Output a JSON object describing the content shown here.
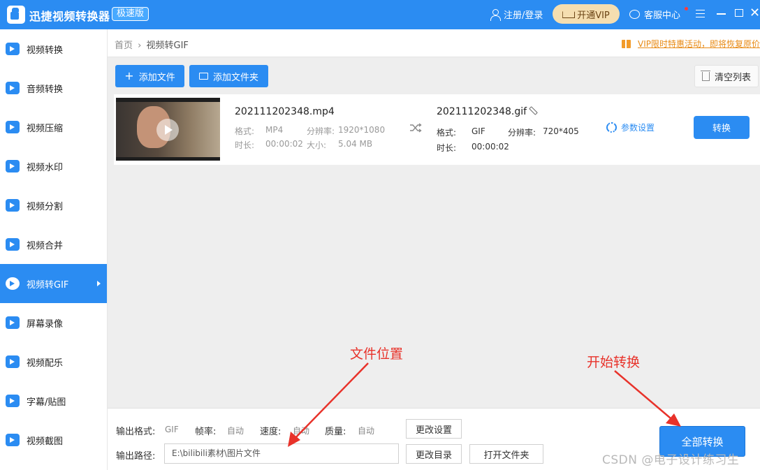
{
  "titlebar": {
    "app_name": "迅捷视频转换器",
    "edition": "极速版",
    "login": "注册/登录",
    "vip": "开通VIP",
    "service": "客服中心"
  },
  "sidebar": {
    "items": [
      {
        "label": "视频转换",
        "icon": "video-convert-icon"
      },
      {
        "label": "音频转换",
        "icon": "audio-convert-icon"
      },
      {
        "label": "视频压缩",
        "icon": "video-compress-icon"
      },
      {
        "label": "视频水印",
        "icon": "watermark-icon"
      },
      {
        "label": "视频分割",
        "icon": "split-icon"
      },
      {
        "label": "视频合并",
        "icon": "merge-icon"
      },
      {
        "label": "视频转GIF",
        "icon": "gif-icon",
        "active": true
      },
      {
        "label": "屏幕录像",
        "icon": "screen-record-icon"
      },
      {
        "label": "视频配乐",
        "icon": "music-icon"
      },
      {
        "label": "字幕/贴图",
        "icon": "subtitle-icon"
      },
      {
        "label": "视频截图",
        "icon": "screenshot-icon"
      }
    ]
  },
  "breadcrumb": {
    "home": "首页",
    "separator": "›",
    "current": "视频转GIF"
  },
  "promo": "VIP限时特惠活动，即将恢复原价",
  "toolbar": {
    "add_file": "添加文件",
    "add_folder": "添加文件夹",
    "clear_list": "清空列表"
  },
  "file": {
    "source": {
      "name": "202111202348.mp4",
      "format_label": "格式:",
      "format": "MP4",
      "resolution_label": "分辨率:",
      "resolution": "1920*1080",
      "duration_label": "时长:",
      "duration": "00:00:02",
      "size_label": "大小:",
      "size": "5.04 MB"
    },
    "output": {
      "name": "202111202348.gif",
      "format_label": "格式:",
      "format": "GIF",
      "resolution_label": "分辨率:",
      "resolution": "720*405",
      "duration_label": "时长:",
      "duration": "00:00:02"
    },
    "params": "参数设置",
    "convert": "转换"
  },
  "bottom": {
    "format_label": "输出格式:",
    "format_value": "GIF",
    "fps_label": "帧率:",
    "fps_value": "自动",
    "speed_label": "速度:",
    "speed_value": "自动",
    "quality_label": "质量:",
    "quality_value": "自动",
    "change_settings": "更改设置",
    "path_label": "输出路径:",
    "path_value": "E:\\bilibili素材\\图片文件",
    "change_dir": "更改目录",
    "open_folder": "打开文件夹",
    "convert_all": "全部转换"
  },
  "annotations": {
    "file_location": "文件位置",
    "start_convert": "开始转换",
    "color": "#e8322a"
  },
  "watermark": "CSDN @电子设计练习生",
  "colors": {
    "accent": "#2b8cf2",
    "vip_bg": "#f5deb0",
    "promo": "#e88a14"
  }
}
